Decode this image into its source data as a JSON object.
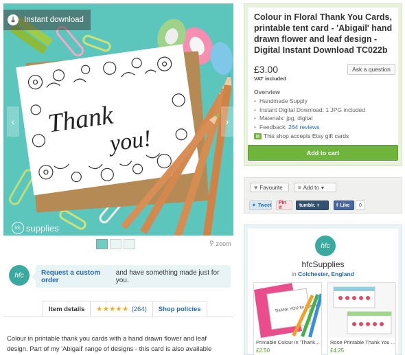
{
  "hero": {
    "badge_label": "Instant download",
    "card_text_line1": "Thank",
    "card_text_line2": "you!",
    "watermark": "supplies",
    "watermark_logo": "hfc"
  },
  "gallery": {
    "zoom_label": "zoom",
    "thumbnail_count": 3,
    "active_thumbnail": 1
  },
  "custom_order": {
    "link_text": "Request a custom order",
    "rest_text": "and have something made just for you.",
    "logo_text": "hfc"
  },
  "tabs": {
    "item_details": "Item details",
    "stars": "★★★★★",
    "review_count": "(264)",
    "shop_policies": "Shop policies"
  },
  "description": "Colour in printable thank you cards with a hand drawn flower and leaf design. Part of my 'Abigail' range of designs - this card is also available with",
  "listing": {
    "title": "Colour in Floral Thank You Cards, printable tent card - 'Abigail' hand drawn flower and leaf design - Digital Instant Download TC022b",
    "price": "£3.00",
    "vat": "VAT included",
    "ask_button": "Ask a question",
    "overview_heading": "Overview",
    "overview": {
      "item1": "Handmade Supply",
      "item2": "Instant Digital Download: 1 JPG included",
      "item3": "Materials: jpg, digital",
      "feedback_prefix": "Feedback:",
      "feedback_link": "264 reviews"
    },
    "gift_text": "This shop accepts Etsy gift cards",
    "add_to_cart": "Add to cart"
  },
  "social": {
    "favourite": "Favourite",
    "add_to": "Add to",
    "tweet": "Tweet",
    "pin": "Pin it",
    "tumblr": "tumblr. +",
    "like": "Like",
    "like_count": "0"
  },
  "shop": {
    "logo_text": "hfc",
    "name": "hfcSupplies",
    "location_prefix": "in",
    "location": "Colchester, England",
    "items": [
      {
        "title": "Printable Colour in 'Thank...",
        "price": "£2.50",
        "card_text": "THANK YOU for helping me grow"
      },
      {
        "title": "Rose Printable Thank You ...",
        "price": "£4.25"
      }
    ]
  },
  "colors": {
    "teal_background": "#5cc6bd",
    "add_to_cart_green": "#6fb53b",
    "link_blue": "#2568b4",
    "star_orange": "#f2a81b"
  }
}
